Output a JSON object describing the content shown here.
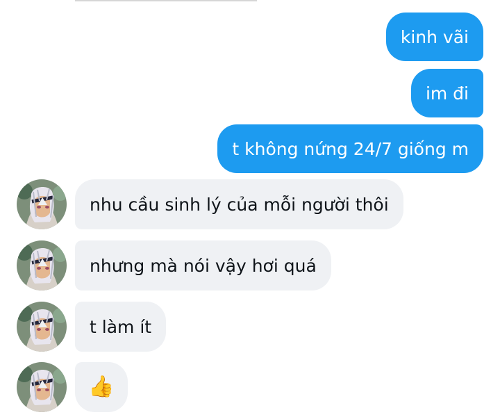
{
  "messages": {
    "sent": [
      "kinh vãi",
      "im đi",
      "t không nứng 24/7 giống m"
    ],
    "received": [
      "nhu cầu sinh lý của mỗi người thôi",
      "nhưng mà nói vậy hơi quá",
      "t làm ít",
      "👍"
    ]
  },
  "icons": {
    "avatar": "profile-avatar",
    "reaction": "thumbs-up-icon"
  },
  "colors": {
    "sent_bubble": "#1d9bf0",
    "received_bubble": "#eff1f4",
    "received_text": "#0f1419",
    "sent_text": "#ffffff"
  }
}
